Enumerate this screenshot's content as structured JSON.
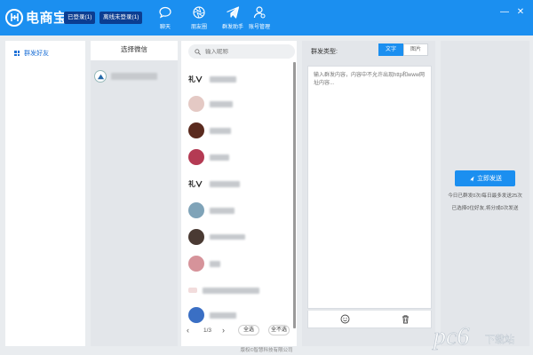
{
  "header": {
    "app_name": "电商宝",
    "logged_in": "已登录(1)",
    "offline": "离线未登录(1)",
    "nav": [
      {
        "label": "聊天",
        "icon": "chat-icon"
      },
      {
        "label": "朋友圈",
        "icon": "aperture-icon"
      },
      {
        "label": "群发助手",
        "icon": "paper-plane-icon"
      },
      {
        "label": "账号管理",
        "icon": "user-manage-icon"
      }
    ],
    "minimize": "—",
    "close": "✕"
  },
  "sidebar": {
    "items": [
      {
        "label": "群发好友",
        "icon": "grid-icon"
      }
    ]
  },
  "accounts": {
    "title": "选择微信"
  },
  "friends": {
    "search_placeholder": "输入昵称",
    "pager": {
      "prev": "‹",
      "next": "›",
      "page": "1/3",
      "select_all": "全选",
      "select_none": "全不选"
    }
  },
  "compose": {
    "type_label": "群发类型:",
    "types": [
      "文字",
      "图片"
    ],
    "selected_type": "文字",
    "placeholder": "输入群发内容，内容中不允许出现http和www网址内容..."
  },
  "right": {
    "send_label": "立即发送",
    "stat_today": "今日已群发0次/每日最多发送25次",
    "stat_selected": "已选择0位好友,将分成0次发送"
  },
  "footer": {
    "copyright": "版权©智慧科技有限公司"
  },
  "watermark": {
    "text": "pc6",
    "sub": "下载站"
  },
  "colors": {
    "accent": "#1b8ff0",
    "pill": "#0b3d91",
    "panel": "#e3e6ea"
  }
}
